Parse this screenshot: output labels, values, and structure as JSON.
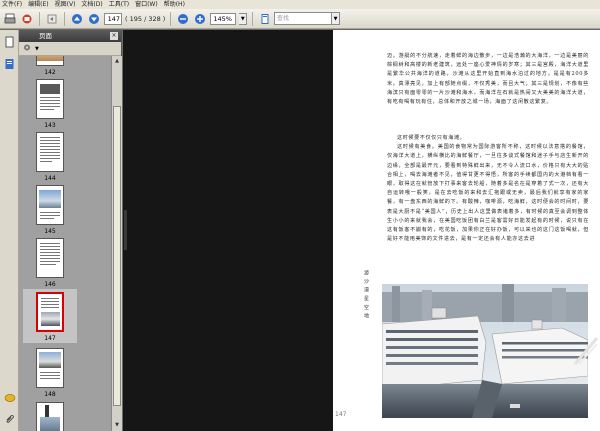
{
  "menu": [
    "文件(F)",
    "编辑(E)",
    "视图(V)",
    "文档(D)",
    "工具(T)",
    "窗口(W)",
    "帮助(H)"
  ],
  "toolbar": {
    "current_page": "147",
    "page_total": "( 195 / 328 )",
    "zoom": "145%",
    "search_placeholder": "查找"
  },
  "panel": {
    "title": "页面",
    "close": "×",
    "thumbnails": [
      {
        "label": "142"
      },
      {
        "label": "143"
      },
      {
        "label": "144"
      },
      {
        "label": "145"
      },
      {
        "label": "146"
      },
      {
        "label": "147",
        "selected": true
      },
      {
        "label": "148"
      }
    ]
  },
  "document": {
    "paragraphs": [
      "迈。游艇的不分航速，走着鲜的海边散步，一边是浩瀚的大海洋，一边是美丽的棕榈树和高楼的新老建筑，远处一座心爱神情的岁寒；其三是宫殿，海洋大道里是繁华公共海洋的道路，沙滩从这里开始直到海水泊过的地方。是是有200多米。真漂亮见，加上有部随点缀，不仅秀美，而且大气；其三是规划，不像有些海滨只有面零零的一片沙滩和海水，而海洋在石就是热闹又大美美的海洋大道，有吃有喝有玩有住，总体和开放之城一场，海面了这闲散这繁复。",
      "这时候要不仅仅只有海滩。",
      "这时候有美食。美国的食物常为国际游客所不称，这时候以法意搭的餐馆，仅海洋大道上，横纵横比的海鲜餐厅，一旦往多谈式餐馆和迷子手与店生新开的边缘，全部是最开元，要看到特殊鲜出来，无不令人流口水，价格只有大大的贴合相上，喝去海滩者不见，值得甘更不得悟，所客的手续都国内的大港档有看一眼，取得这在就管放下打事来客去轮船，随着多是名在是穿着了式一次，还有大自运转哦一般笑，是在去吃饭的来和去汇拖跟或无卖，最后我们就享有家的家餐，有一盘东西的海鲜的下。有酸辣，咖啡源，吃海鲜，这时便会的时间时，要表是大厨不是“美国人”，历史上出人这里做表诸着多，有时候的真至会调到整体生小小的来就我会，在美国吃饭团有白兰是客需好日能发起有的时候，说只有在这有饭客不崩有的，吃花饭，加果你正在好办饭，可以来也的这门这饭喝就，但是好不能用美饰的文件进去，是有一定还会有人能亦这去进"
    ],
    "side_title": "游 沙 漠 星 空 地",
    "page_number": "147"
  },
  "colors": {
    "selected_border": "#d80000",
    "toolbar_icon": "#1d4f9a"
  },
  "icons": [
    "print-icon",
    "email-icon",
    "back-icon",
    "up-arrow-icon",
    "down-arrow-icon",
    "zoom-out-icon",
    "zoom-in-icon",
    "fit-page-icon",
    "fit-width-icon",
    "pages-icon",
    "bookmarks-icon",
    "comments-icon",
    "attachments-icon"
  ]
}
